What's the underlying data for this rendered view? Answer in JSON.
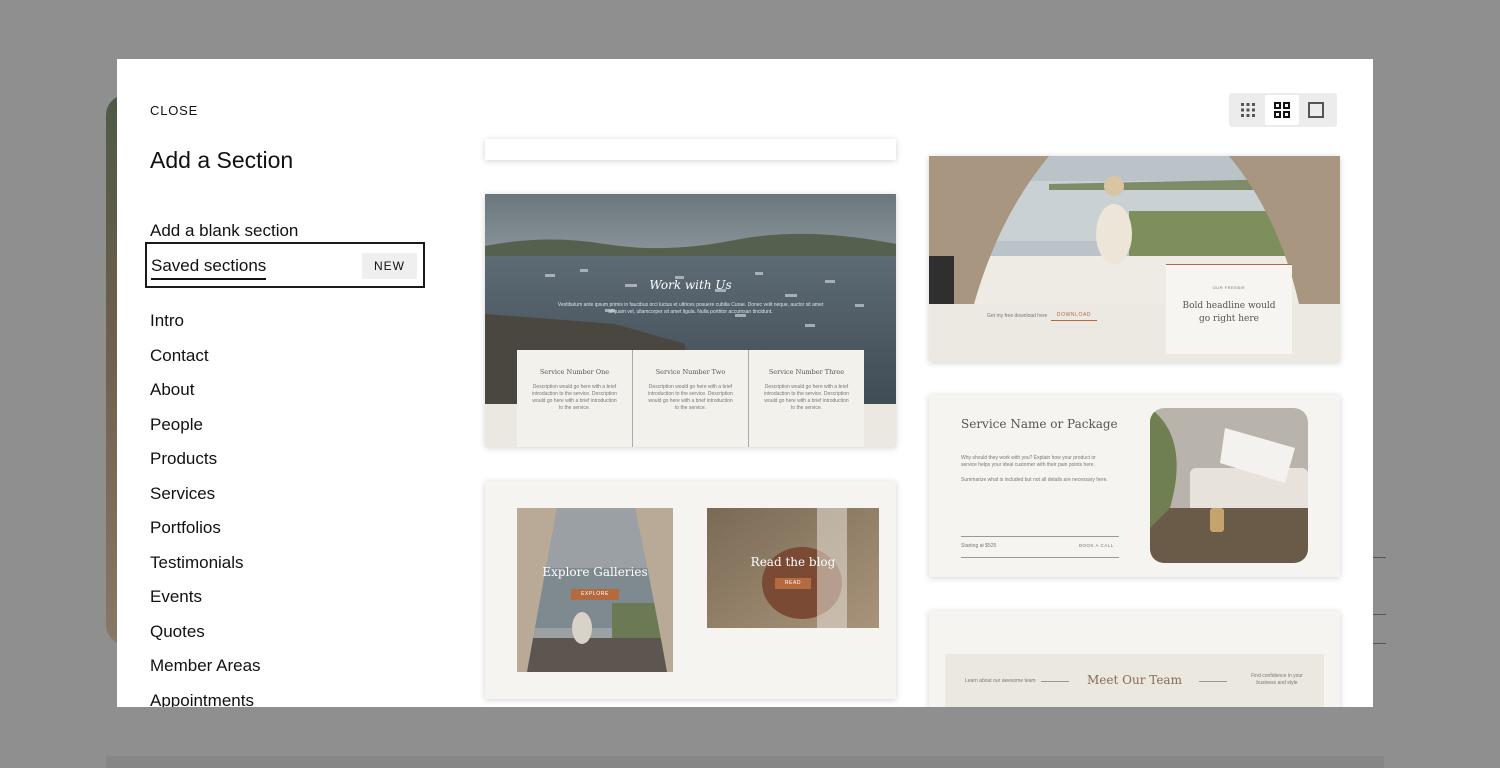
{
  "modal": {
    "close_label": "CLOSE",
    "title": "Add a Section",
    "blank_section": "Add a blank section",
    "saved_sections": "Saved sections",
    "new_badge": "NEW"
  },
  "categories": [
    "Intro",
    "Contact",
    "About",
    "People",
    "Products",
    "Services",
    "Portfolios",
    "Testimonials",
    "Events",
    "Quotes",
    "Member Areas",
    "Appointments"
  ],
  "view_modes": [
    "small-grid",
    "large-grid",
    "single"
  ],
  "cards": {
    "work": {
      "title": "Work with Us",
      "body": "Vestibulum ante ipsum primis in faucibus orci luctus et ultrices posuere cubilia Curae. Donec velit neque, auctor sit amet aliquam vel, ullamcorper sit amet ligula. Nulla porttitor accumsan tincidunt.",
      "services": [
        {
          "name": "Service Number One",
          "desc": "Description would go here with a brief introduction to the service. Description would go here with a brief introduction to the service."
        },
        {
          "name": "Service Number Two",
          "desc": "Description would go here with a brief introduction to the service. Description would go here with a brief introduction to the service."
        },
        {
          "name": "Service Number Three",
          "desc": "Description would go here with a brief introduction to the service. Description would go here with a brief introduction to the service."
        }
      ]
    },
    "freebie": {
      "tag": "OUR FREEBIE",
      "headline": "Bold headline would go right here",
      "download_text": "Get my free download here",
      "download_btn": "DOWNLOAD"
    },
    "gallery": {
      "explore_title": "Explore Galleries",
      "explore_btn": "EXPLORE",
      "blog_title": "Read the blog",
      "blog_btn": "READ"
    },
    "service": {
      "title": "Service Name or Package",
      "line1": "Why should they work with you? Explain how your product or service helps your ideal customer with their pain points here.",
      "line2": "Summarize what is included but not all details are necessary here.",
      "price": "Starting at $525",
      "cta": "BOOK A CALL"
    },
    "team": {
      "title": "Meet Our Team",
      "left": "Learn about our awesome team",
      "right": "Find confidence in your business and style"
    }
  },
  "colors": {
    "accent": "#b5693f",
    "overlay": "#f6f4f0",
    "border": "#1a1a1a"
  }
}
